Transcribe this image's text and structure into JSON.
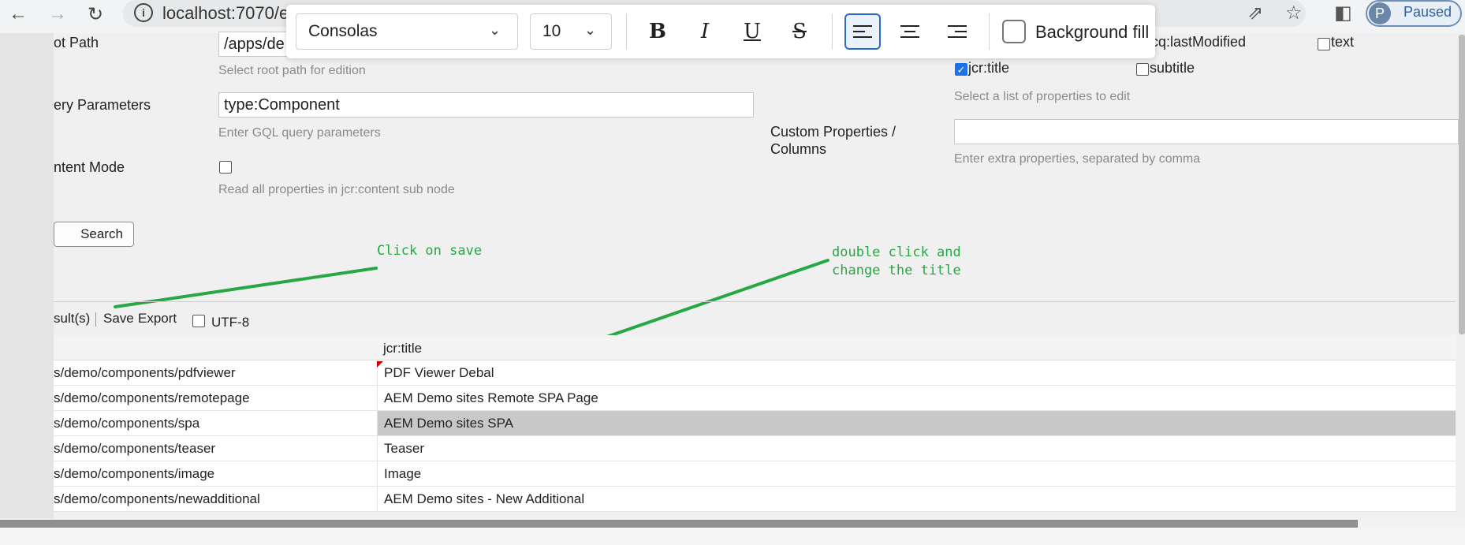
{
  "browser": {
    "url": "localhost:7070/et",
    "profile_initial": "P",
    "profile_status": "Paused"
  },
  "format_toolbar": {
    "font": "Consolas",
    "font_size": "10",
    "bold": "B",
    "italic": "I",
    "underline": "U",
    "strike": "S",
    "background_fill_label": "Background fill"
  },
  "form": {
    "root_path_label": "ot Path",
    "root_path_value": "/apps/de",
    "root_path_hint": "Select root path for edition",
    "query_label": "ery Parameters",
    "query_value": "type:Component",
    "query_hint": "Enter GQL query parameters",
    "content_mode_label": "ntent Mode",
    "content_mode_hint": "Read all properties in jcr:content sub node",
    "search_button": "Search",
    "properties": [
      {
        "label": "cq:lastModified",
        "checked": false
      },
      {
        "label": "text",
        "checked": false
      },
      {
        "label": "jcr:title",
        "checked": true
      },
      {
        "label": "subtitle",
        "checked": false
      }
    ],
    "properties_hint": "Select a list of properties to edit",
    "custom_label": "Custom Properties / Columns",
    "custom_hint": "Enter extra properties, separated by comma"
  },
  "annotations": {
    "save": "Click on save",
    "title": "double click and\nchange the title"
  },
  "results": {
    "count_label": "sult(s)",
    "save": "Save",
    "export": "Export",
    "utf8": "UTF-8"
  },
  "table": {
    "title_header": "jcr:title",
    "rows": [
      {
        "path": "s/demo/components/pdfviewer",
        "title": "PDF Viewer Debal"
      },
      {
        "path": "s/demo/components/remotepage",
        "title": "AEM Demo sites Remote SPA Page"
      },
      {
        "path": "s/demo/components/spa",
        "title": "AEM Demo sites SPA"
      },
      {
        "path": "s/demo/components/teaser",
        "title": "Teaser"
      },
      {
        "path": "s/demo/components/image",
        "title": "Image"
      },
      {
        "path": "s/demo/components/newadditional",
        "title": "AEM Demo sites - New Additional"
      }
    ]
  }
}
